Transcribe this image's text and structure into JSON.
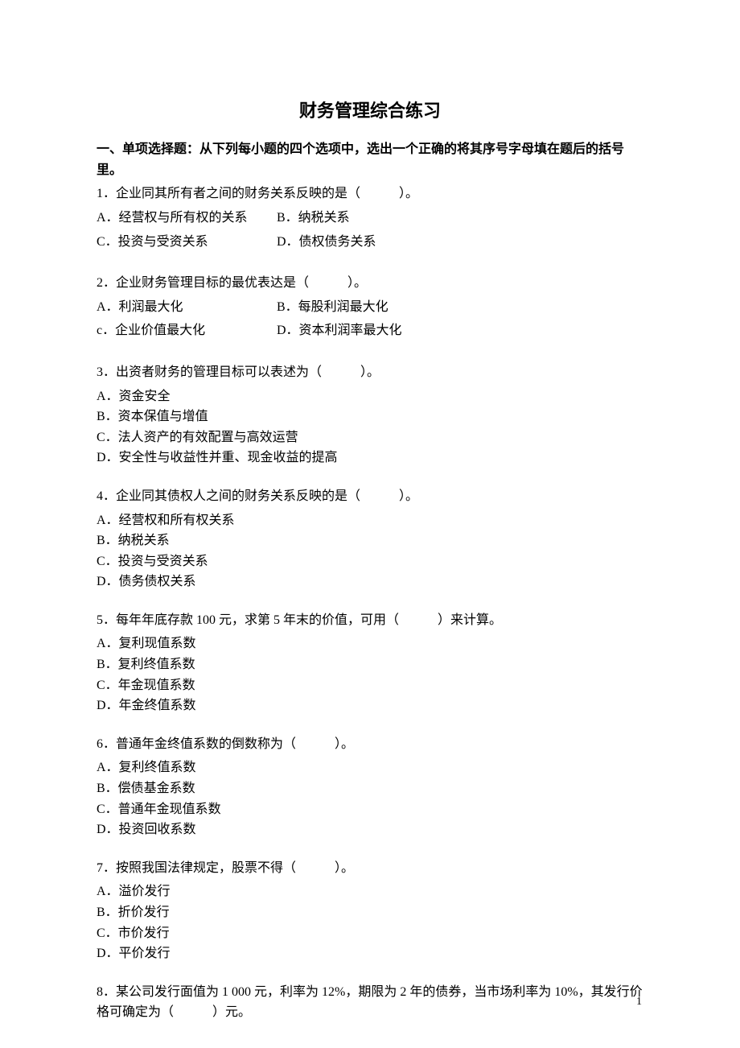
{
  "title": "财务管理综合练习",
  "section_header": "一、单项选择题：从下列每小题的四个选项中，选出一个正确的将其序号字母填在题后的括号里。",
  "q1": {
    "text": "1．企业同其所有者之间的财务关系反映的是（　　　）。",
    "a": "A．经营权与所有权的关系",
    "b": "B．纳税关系",
    "c": "C．投资与受资关系",
    "d": "D．债权债务关系"
  },
  "q2": {
    "text": "2．企业财务管理目标的最优表达是（　　　）。",
    "a": "A．利润最大化",
    "b": "B．每股利润最大化",
    "c": "c．企业价值最大化",
    "d": "D．资本利润率最大化"
  },
  "q3": {
    "text": "3．出资者财务的管理目标可以表述为（　　　）。",
    "a": "A．资金安全",
    "b": "B．资本保值与增值",
    "c": "C．法人资产的有效配置与高效运营",
    "d": "D．安全性与收益性并重、现金收益的提高"
  },
  "q4": {
    "text": "4．企业同其债权人之间的财务关系反映的是（　　　）。",
    "a": "A．经营权和所有权关系",
    "b": "B．纳税关系",
    "c": "C．投资与受资关系",
    "d": "D．债务债权关系"
  },
  "q5": {
    "text": "5．每年年底存款 100 元，求第 5 年末的价值，可用（　　　）来计算。",
    "a": "A．复利现值系数",
    "b": "B．复利终值系数",
    "c": "C．年金现值系数",
    "d": "D．年金终值系数"
  },
  "q6": {
    "text": "6．普通年金终值系数的倒数称为（　　　）。",
    "a": "A．复利终值系数",
    "b": "B．偿债基金系数",
    "c": "C．普通年金现值系数",
    "d": "D．投资回收系数"
  },
  "q7": {
    "text": "7．按照我国法律规定，股票不得（　　　）。",
    "a": "A．溢价发行",
    "b": "B．折价发行",
    "c": "C．市价发行",
    "d": "D．平价发行"
  },
  "q8": {
    "text": "8．某公司发行面值为 1 000 元，利率为 12%，期限为 2 年的债券，当市场利率为 10%，其发行价格可确定为（　　　）元。"
  },
  "page_number": "1"
}
